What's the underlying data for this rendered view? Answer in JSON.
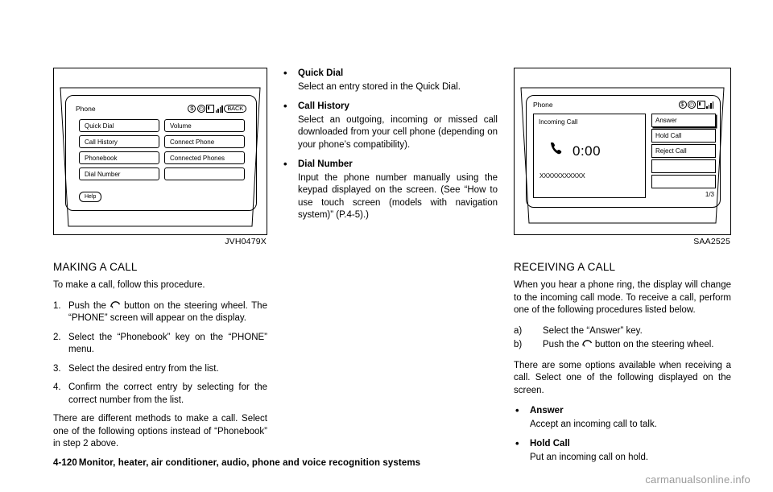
{
  "figures": {
    "left": {
      "label": "JVH0479X",
      "screen": {
        "title": "Phone",
        "status_icons": [
          "dollar-circle-icon",
          "clock-icon",
          "sd-card-icon",
          "signal-bars-icon",
          "bluetooth-badge-icon"
        ],
        "badge_text": "BACK",
        "buttons": [
          [
            "Quick Dial",
            "Volume"
          ],
          [
            "Call History",
            "Connect Phone"
          ],
          [
            "Phonebook",
            "Connected Phones"
          ],
          [
            "Dial Number",
            ""
          ]
        ],
        "help_label": "Help"
      }
    },
    "right": {
      "label": "SAA2525",
      "screen": {
        "title": "Phone",
        "status_icons": [
          "dollar-circle-icon",
          "clock-icon",
          "sd-card-icon",
          "signal-bars-icon"
        ],
        "incoming_label": "Incoming Call",
        "timer": "0:00",
        "number": "XXXXXXXXXXX",
        "buttons": [
          "Answer",
          "Hold Call",
          "Reject Call",
          "",
          ""
        ],
        "page_indicator": "1/3"
      }
    }
  },
  "left_column": {
    "heading": "MAKING A CALL",
    "intro": "To make a call, follow this procedure.",
    "steps": [
      {
        "num": "1.",
        "text_before": "Push the",
        "text_after": "button on the steering wheel. The “PHONE” screen will appear on the display."
      },
      {
        "num": "2.",
        "text": "Select the “Phonebook” key on the “PHONE” menu."
      },
      {
        "num": "3.",
        "text": "Select the desired entry from the list."
      },
      {
        "num": "4.",
        "text": "Confirm the correct entry by selecting for the correct number from the list."
      }
    ],
    "closing": "There are different methods to make a call. Select one of the following options instead of “Phonebook” in step 2 above."
  },
  "middle_column": {
    "bullets": [
      {
        "title": "Quick Dial",
        "body": "Select an entry stored in the Quick Dial."
      },
      {
        "title": "Call History",
        "body": "Select an outgoing, incoming or missed call downloaded from your cell phone (depending on your phone’s compatibility)."
      },
      {
        "title": "Dial Number",
        "body": "Input the phone number manually using the keypad displayed on the screen. (See “How to use touch screen (models with navigation system)” (P.4-5).)"
      }
    ]
  },
  "right_column": {
    "heading": "RECEIVING A CALL",
    "intro": "When you hear a phone ring, the display will change to the incoming call mode. To receive a call, perform one of the following procedures listed below.",
    "options": [
      {
        "label": "a)",
        "text": "Select the “Answer” key."
      },
      {
        "label": "b)",
        "text_before": "Push the",
        "text_after": "button on the steering wheel."
      }
    ],
    "mid_paragraph": "There are some options available when receiving a call. Select one of the following displayed on the screen.",
    "bullets": [
      {
        "title": "Answer",
        "body": "Accept an incoming call to talk."
      },
      {
        "title": "Hold Call",
        "body": "Put an incoming call on hold."
      }
    ]
  },
  "footer": {
    "page_number": "4-120",
    "chapter": "Monitor, heater, air conditioner, audio, phone and voice recognition systems",
    "watermark": "carmanualsonline.info"
  }
}
